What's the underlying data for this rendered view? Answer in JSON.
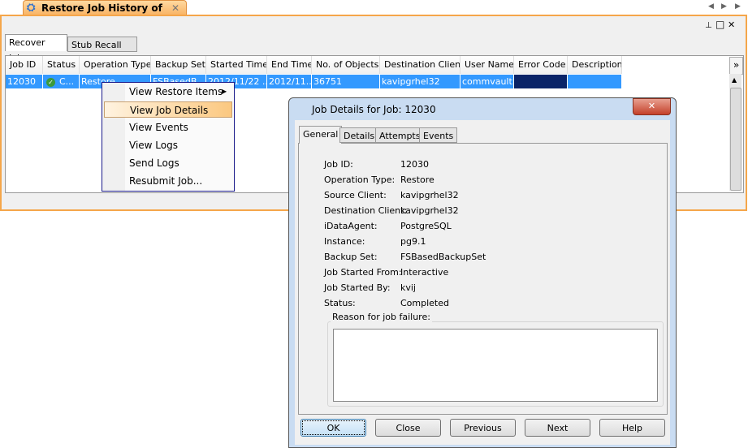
{
  "doc_tab": {
    "title": "Restore Job History of pg...",
    "close": "✕"
  },
  "nav": {
    "left": "◀",
    "right": "▶"
  },
  "window_controls": {
    "pin": "⊥",
    "restore": "□",
    "close": "✕"
  },
  "subtabs": [
    "Recover Jobs",
    "Stub Recall Jobs"
  ],
  "table": {
    "columns": [
      "Job ID",
      "Status",
      "Operation Type",
      "Backup Set",
      "Started Time",
      "End Time",
      "No. of Objects",
      "Destination Client",
      "User Name",
      "Error Code",
      "Description"
    ],
    "rows": [
      [
        "12030",
        "C...",
        "Restore",
        "FSBasedB...",
        "2012/11/22 ...",
        "2012/11...",
        "36751",
        "kavipgrhel32",
        "commvault...",
        "",
        ""
      ]
    ],
    "overflow": "»"
  },
  "context_menu": {
    "items": [
      "View Restore Items",
      "View Job Details",
      "View Events",
      "View Logs",
      "Send Logs",
      "Resubmit Job..."
    ],
    "highlighted": "View Job Details"
  },
  "dialog": {
    "title": "Job Details for Job: 12030",
    "tabs": [
      "General",
      "Details",
      "Attempts",
      "Events"
    ],
    "fields": [
      {
        "label": "Job ID:",
        "value": "12030"
      },
      {
        "label": "Operation Type:",
        "value": "Restore"
      },
      {
        "label": "Source Client:",
        "value": "kavipgrhel32"
      },
      {
        "label": "Destination Client:",
        "value": "kavipgrhel32"
      },
      {
        "label": "iDataAgent:",
        "value": "PostgreSQL"
      },
      {
        "label": "Instance:",
        "value": "pg9.1"
      },
      {
        "label": "Backup Set:",
        "value": "FSBasedBackupSet"
      },
      {
        "label": "Job Started From:",
        "value": "Interactive"
      },
      {
        "label": "Job Started By:",
        "value": "kvij"
      },
      {
        "label": "Status:",
        "value": "Completed"
      }
    ],
    "failure_label": "Reason for job failure:",
    "failure_text": "",
    "buttons": [
      "OK",
      "Close",
      "Previous",
      "Next",
      "Help"
    ]
  },
  "colors": {
    "selection": "#3399ff",
    "accent": "#f5a64a",
    "error_cell": "#0a2468"
  }
}
